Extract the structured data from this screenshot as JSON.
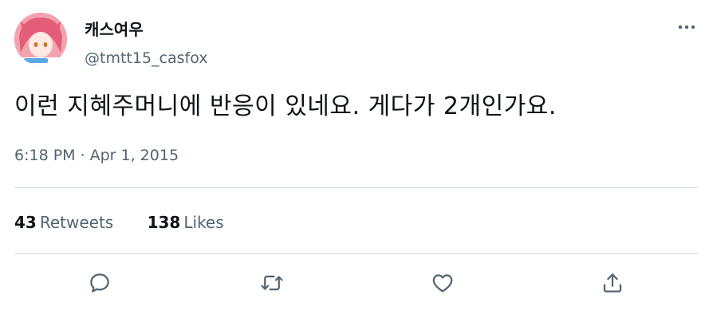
{
  "author": {
    "display_name": "캐스여우",
    "handle": "@tmtt15_casfox"
  },
  "tweet": {
    "text": "이런 지혜주머니에 반응이 있네요. 게다가 2개인가요.",
    "time": "6:18 PM",
    "separator": "·",
    "date": "Apr 1, 2015"
  },
  "stats": {
    "retweets_count": "43",
    "retweets_label": "Retweets",
    "likes_count": "138",
    "likes_label": "Likes"
  },
  "icons": {
    "more": "more-horizontal-icon",
    "reply": "reply-icon",
    "retweet": "retweet-icon",
    "like": "heart-icon",
    "share": "share-icon"
  },
  "colors": {
    "text_primary": "#0f1419",
    "text_secondary": "#536471",
    "divider": "#cfd9de"
  }
}
